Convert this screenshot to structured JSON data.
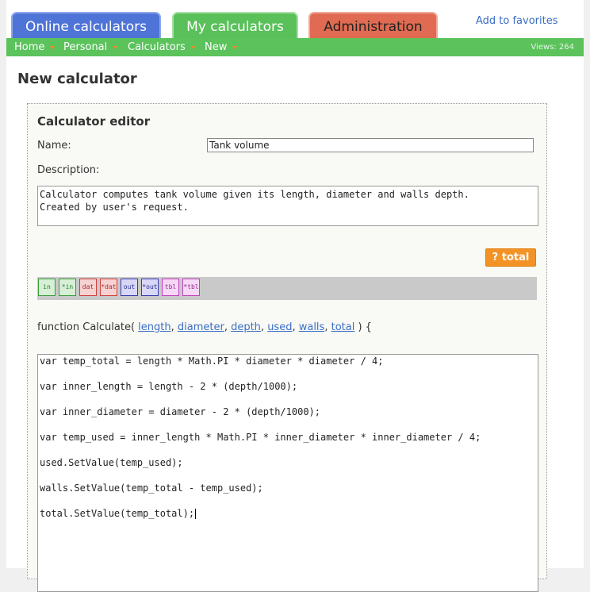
{
  "tabs": {
    "online": "Online calculators",
    "my": "My calculators",
    "admin": "Administration"
  },
  "favorites": "Add to favorites",
  "nav": {
    "items": [
      "Home",
      "Personal",
      "Calculators",
      "New"
    ],
    "views": "Views: 264"
  },
  "page_title": "New calculator",
  "editor": {
    "title": "Calculator editor",
    "name_label": "Name:",
    "name_value": "Tank volume",
    "description_label": "Description:",
    "description_value": "Calculator computes tank volume given its length, diameter and walls depth.\nCreated by user's request.",
    "total_button": "? total",
    "toolbar_buttons": [
      {
        "label": "in",
        "kind": "in"
      },
      {
        "label": "*in",
        "kind": "in"
      },
      {
        "label": "dat",
        "kind": "dat"
      },
      {
        "label": "*dat",
        "kind": "dat"
      },
      {
        "label": "out",
        "kind": "out"
      },
      {
        "label": "*out",
        "kind": "out"
      },
      {
        "label": "tbl",
        "kind": "tbl"
      },
      {
        "label": "*tbl",
        "kind": "tbl"
      }
    ],
    "function_prefix": "function Calculate(",
    "params": [
      "length",
      "diameter",
      "depth",
      "used",
      "walls",
      "total"
    ],
    "function_suffix": ") {",
    "code_lines": [
      "var temp_total = length * Math.PI * diameter * diameter / 4;",
      "var inner_length = length - 2 * (depth/1000);",
      "var inner_diameter = diameter - 2 * (depth/1000);",
      "var temp_used = inner_length * Math.PI * inner_diameter * inner_diameter / 4;",
      "used.SetValue(temp_used);",
      "walls.SetValue(temp_total - temp_used);",
      "total.SetValue(temp_total);"
    ]
  },
  "colors": {
    "tab_online": "#4f74d7",
    "tab_my": "#59c05a",
    "tab_admin": "#e06b52",
    "navbar": "#5bc25c",
    "accent_button": "#f39325",
    "link": "#3b6fc4"
  }
}
